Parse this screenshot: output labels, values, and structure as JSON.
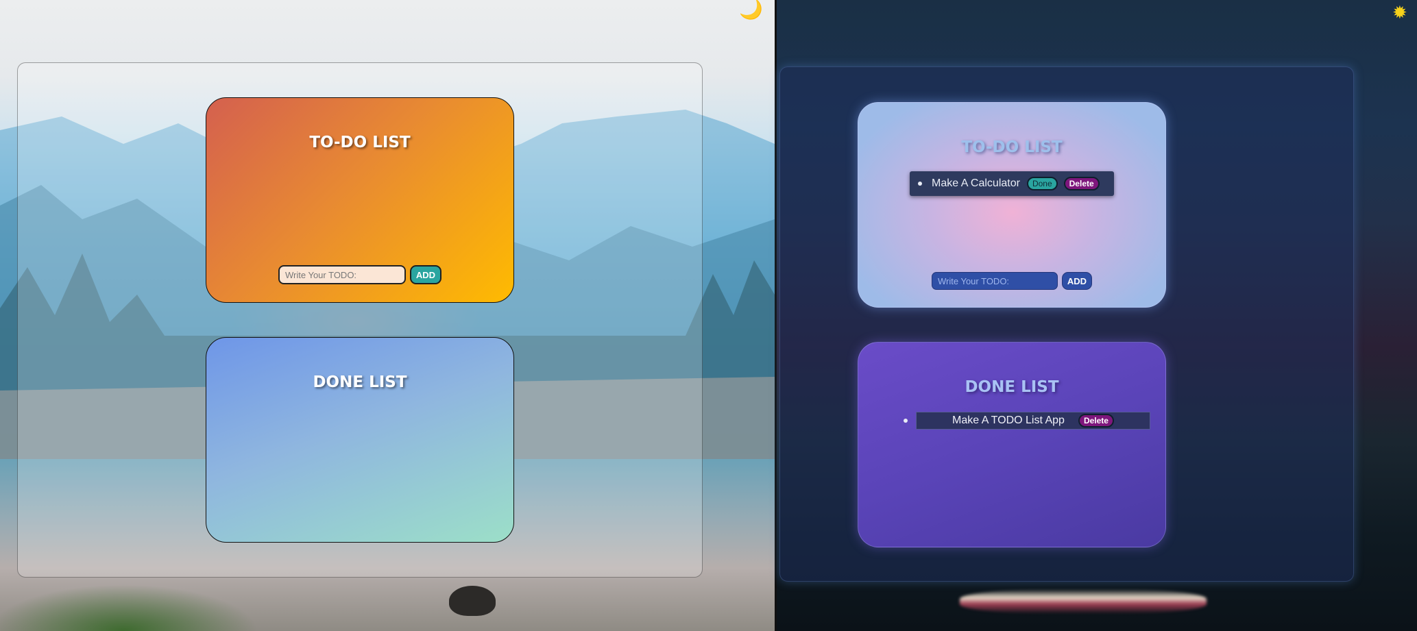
{
  "light_theme": {
    "toggle_icon": "moon-icon",
    "todo_card": {
      "title": "TO-DO LIST",
      "input_placeholder": "Write Your TODO:",
      "add_label": "ADD"
    },
    "done_card": {
      "title": "DONE LIST"
    },
    "colors": {
      "todo_start": "#d4604f",
      "todo_end": "#ffbb00",
      "done_start": "#6e96e8",
      "done_end": "#9cdfc8",
      "add_button": "#2aa5a0"
    }
  },
  "dark_theme": {
    "toggle_icon": "sun-icon",
    "todo_card": {
      "title": "TO-DO LIST",
      "items": [
        {
          "text": "Make A Calculator",
          "done_label": "Done",
          "delete_label": "Delete"
        }
      ],
      "input_placeholder": "Write Your TODO:",
      "add_label": "ADD"
    },
    "done_card": {
      "title": "DONE LIST",
      "items": [
        {
          "text": "Make A TODO List App",
          "delete_label": "Delete"
        }
      ]
    },
    "colors": {
      "done_button": "#2aa5a0",
      "delete_button": "#7e167c",
      "input": "#2f4fa6",
      "done_card": "#5a44b8"
    }
  }
}
